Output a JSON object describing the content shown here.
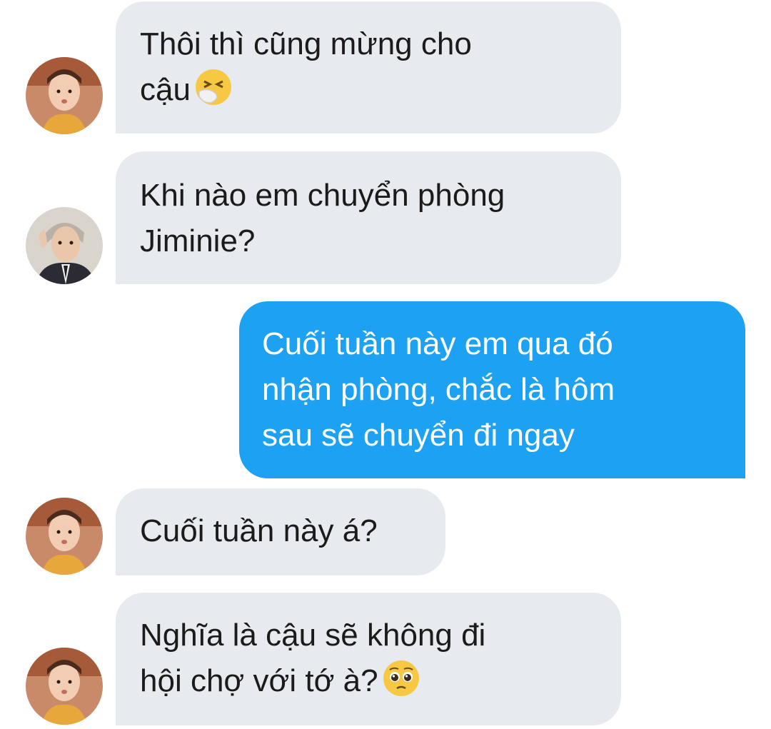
{
  "messages": [
    {
      "sender": "friend-v",
      "direction": "incoming",
      "lines": [
        "Thôi thì cũng mừng cho",
        "cậu"
      ],
      "emoji": "sneezing-face-icon"
    },
    {
      "sender": "friend-rm",
      "direction": "incoming",
      "lines": [
        "Khi nào em chuyển phòng",
        "Jiminie?"
      ]
    },
    {
      "sender": "me",
      "direction": "outgoing",
      "lines": [
        "Cuối tuần này em qua đó",
        "nhận phòng, chắc là hôm",
        "sau sẽ chuyển đi ngay"
      ]
    },
    {
      "sender": "friend-v",
      "direction": "incoming",
      "lines": [
        "Cuối tuần này á?"
      ]
    },
    {
      "sender": "friend-v",
      "direction": "incoming",
      "lines": [
        "Nghĩa là cậu sẽ không đi",
        "hội chợ với tớ à?"
      ],
      "emoji": "pleading-face-icon"
    }
  ],
  "colors": {
    "incoming_bubble": "#e7ebef",
    "outgoing_bubble": "#1da1f2",
    "incoming_text": "#1b1b1b",
    "outgoing_text": "#ffffff"
  }
}
